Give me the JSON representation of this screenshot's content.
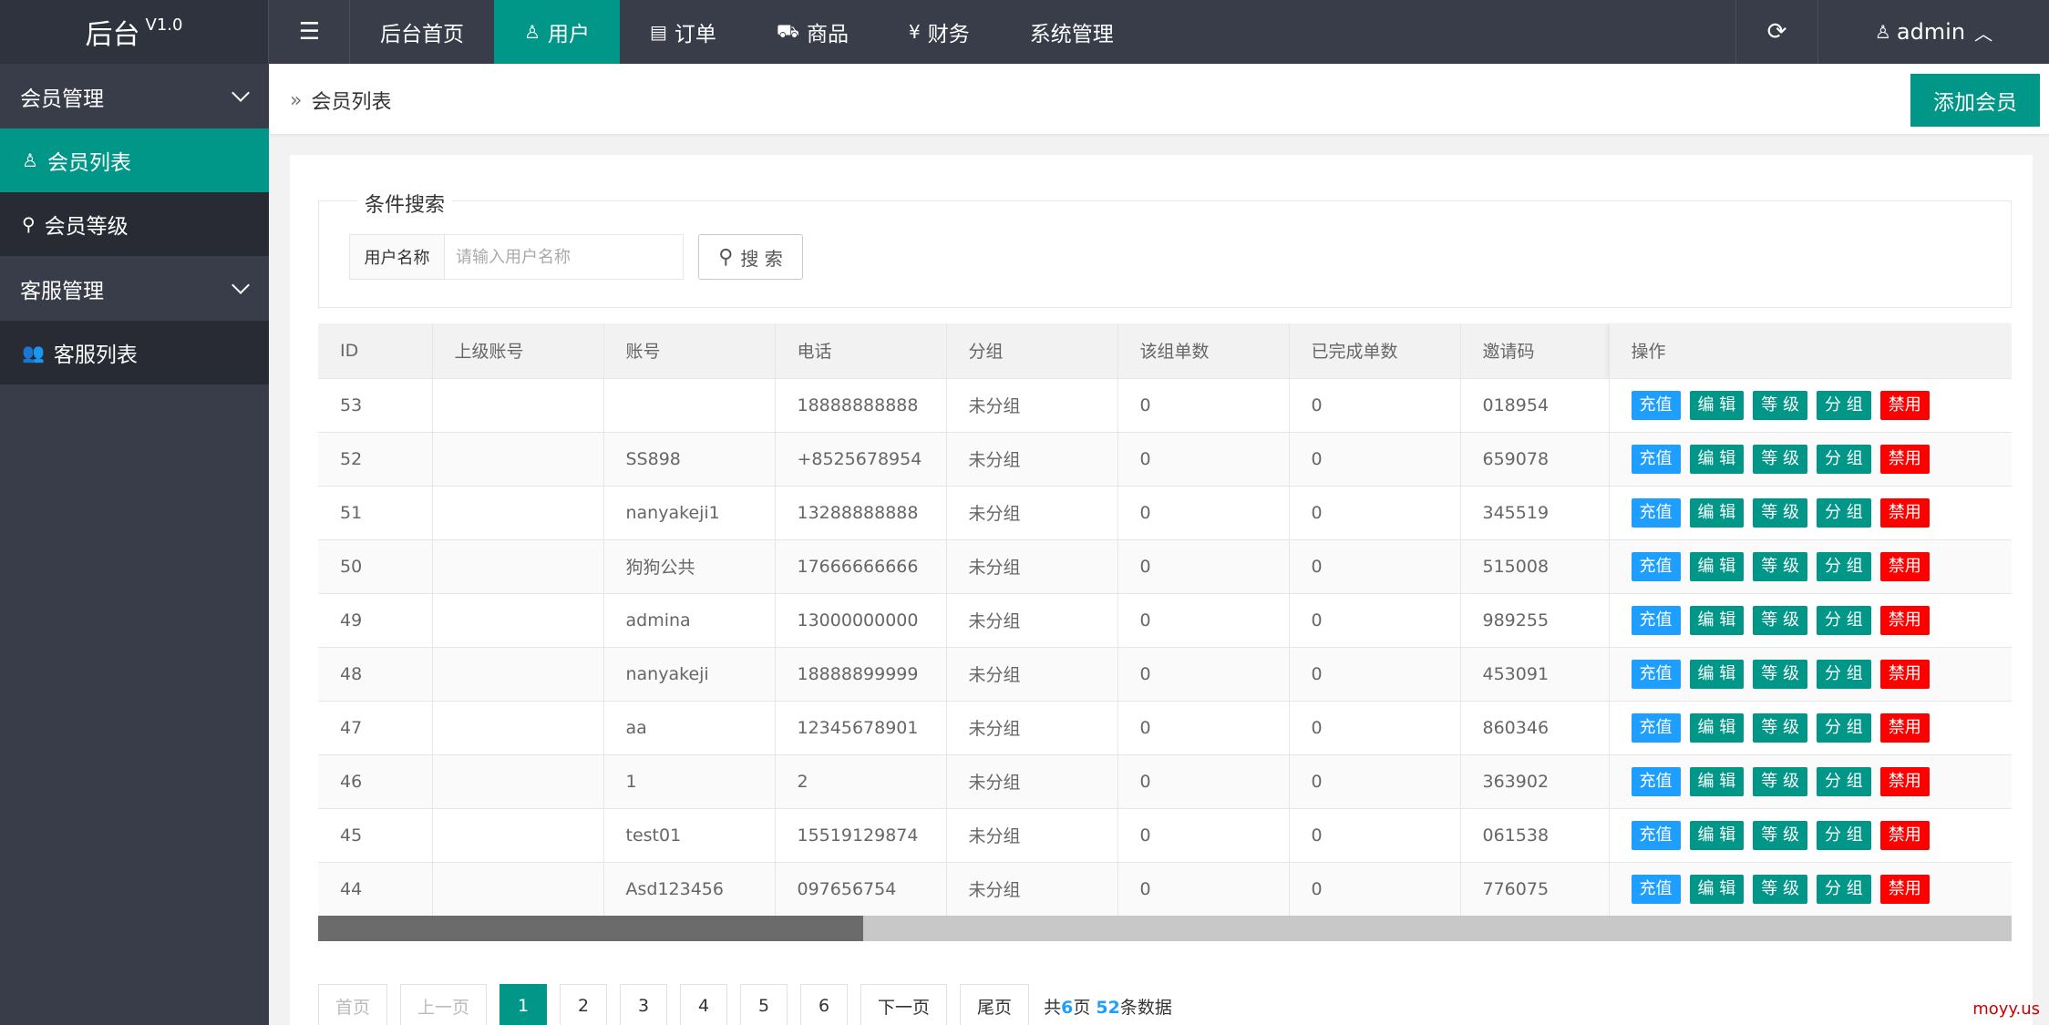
{
  "header": {
    "logo": "后台",
    "version": "V1.0",
    "nav": [
      {
        "label": "后台首页",
        "icon": "",
        "active": false
      },
      {
        "label": "用户",
        "icon": "user-icon",
        "active": true
      },
      {
        "label": "订单",
        "icon": "document-icon",
        "active": false
      },
      {
        "label": "商品",
        "icon": "cart-icon",
        "active": false
      },
      {
        "label": "财务",
        "icon": "yen-icon",
        "active": false
      },
      {
        "label": "系统管理",
        "icon": "",
        "active": false
      }
    ],
    "user": "admin"
  },
  "sidebar": {
    "group1": "会员管理",
    "item1": "会员列表",
    "item2": "会员等级",
    "group2": "客服管理",
    "item3": "客服列表"
  },
  "breadcrumb": "会员列表",
  "add_button": "添加会员",
  "search": {
    "legend": "条件搜索",
    "label": "用户名称",
    "placeholder": "请输入用户名称",
    "button": "搜 索"
  },
  "table": {
    "headers": [
      "ID",
      "上级账号",
      "账号",
      "电话",
      "分组",
      "该组单数",
      "已完成单数",
      "邀请码",
      "操作"
    ],
    "actions": [
      "充值",
      "编 辑",
      "等 级",
      "分 组",
      "禁用"
    ],
    "rows": [
      [
        "53",
        "",
        "",
        "18888888888",
        "未分组",
        "0",
        "0",
        "018954"
      ],
      [
        "52",
        "",
        "SS898",
        "+8525678954",
        "未分组",
        "0",
        "0",
        "659078"
      ],
      [
        "51",
        "",
        "nanyakeji1",
        "13288888888",
        "未分组",
        "0",
        "0",
        "345519"
      ],
      [
        "50",
        "",
        "狗狗公共",
        "17666666666",
        "未分组",
        "0",
        "0",
        "515008"
      ],
      [
        "49",
        "",
        "admina",
        "13000000000",
        "未分组",
        "0",
        "0",
        "989255"
      ],
      [
        "48",
        "",
        "nanyakeji",
        "18888899999",
        "未分组",
        "0",
        "0",
        "453091"
      ],
      [
        "47",
        "",
        "aa",
        "12345678901",
        "未分组",
        "0",
        "0",
        "860346"
      ],
      [
        "46",
        "",
        "1",
        "2",
        "未分组",
        "0",
        "0",
        "363902"
      ],
      [
        "45",
        "",
        "test01",
        "15519129874",
        "未分组",
        "0",
        "0",
        "061538"
      ],
      [
        "44",
        "",
        "Asd123456",
        "097656754",
        "未分组",
        "0",
        "0",
        "776075"
      ]
    ]
  },
  "pagination": {
    "first": "首页",
    "prev": "上一页",
    "pages": [
      "1",
      "2",
      "3",
      "4",
      "5",
      "6"
    ],
    "current": "1",
    "next": "下一页",
    "last": "尾页",
    "info_prefix": "共",
    "total_pages": "6",
    "info_mid": "页",
    "total_records": "52",
    "info_suffix": "条数据"
  },
  "watermark": "moyy.us",
  "colors": {
    "accent": "#009688",
    "recharge": "#1e9fff",
    "ban": "#ff0000",
    "header": "#393d49"
  }
}
